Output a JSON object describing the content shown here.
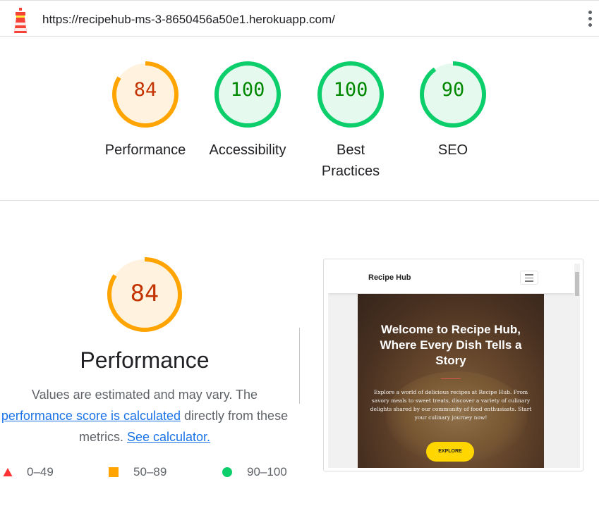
{
  "url_bar": {
    "url": "https://recipehub-ms-3-8650456a50e1.herokuapp.com/"
  },
  "categories": [
    {
      "label": "Performance",
      "score": 84,
      "rating": "average"
    },
    {
      "label": "Accessibility",
      "score": 100,
      "rating": "pass"
    },
    {
      "label": "Best Practices",
      "score": 100,
      "rating": "pass"
    },
    {
      "label": "SEO",
      "score": 90,
      "rating": "pass"
    }
  ],
  "colors": {
    "pass": "#0cce6b",
    "pass_text": "#008800",
    "pass_bg": "#e6f9ee",
    "average": "#ffa400",
    "average_text": "#c33300",
    "average_bg": "#fff3e0",
    "fail": "#ff3333",
    "link": "#1a73e8"
  },
  "performance_section": {
    "score": 84,
    "title": "Performance",
    "desc_prefix": "Values are estimated and may vary. The",
    "link_score": "performance score is calculated",
    "desc_middle": "directly from these metrics.",
    "link_calculator": "See calculator."
  },
  "legend": [
    {
      "range": "0–49",
      "icon": "triangle-icon"
    },
    {
      "range": "50–89",
      "icon": "square-icon"
    },
    {
      "range": "90–100",
      "icon": "circle-icon"
    }
  ],
  "screenshot": {
    "brand": "Recipe Hub",
    "hero_title": "Welcome to Recipe Hub, Where Every Dish Tells a Story",
    "hero_text": "Explore a world of delicious recipes at Recipe Hub. From savory meals to sweet treats, discover a variety of culinary delights shared by our community of food enthusiasts. Start your culinary journey now!",
    "button": "EXPLORE"
  }
}
